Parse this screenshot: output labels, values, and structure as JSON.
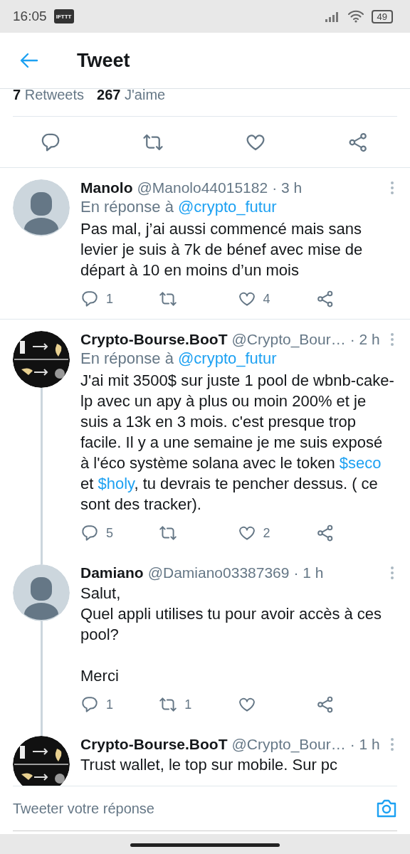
{
  "status_bar": {
    "time": "16:05",
    "notification": "IFTTT",
    "battery": "49"
  },
  "header": {
    "title": "Tweet"
  },
  "stats": [
    {
      "count": "7",
      "label": "Retweets"
    },
    {
      "count": "267",
      "label": "J'aime"
    }
  ],
  "tweets": [
    {
      "name": "Manolo",
      "handle": "@Manolo44015182",
      "time": "· 3 h",
      "kind": "default",
      "reply_prefix": "En réponse à",
      "reply_to": "@crypto_futur",
      "body": [
        {
          "text": "Pas mal, j’ai aussi commencé mais sans levier je suis à 7k de bénef avec mise de départ à 10 en moins d’un mois",
          "link": false
        }
      ],
      "replies": "1",
      "likes": "4",
      "connected_below": false
    },
    {
      "name": "Crypto-Bourse.BooT",
      "handle": "@Crypto_Bour…",
      "time": "· 2 h",
      "kind": "image",
      "reply_prefix": "En réponse à",
      "reply_to": "@crypto_futur",
      "body": [
        {
          "text": "J'ai mit 3500$ sur juste 1 pool de wbnb-cake-lp avec un apy à plus ou moin 200% et je suis a 13k en 3 mois. c'est presque trop facile. Il y a une semaine je me suis exposé à l'éco système solana avec le token ",
          "link": false
        },
        {
          "text": "$seco",
          "link": true
        },
        {
          "text": " et ",
          "link": false
        },
        {
          "text": "$holy",
          "link": true
        },
        {
          "text": ", tu devrais te pencher dessus. ( ce sont des tracker).",
          "link": false
        }
      ],
      "replies": "5",
      "likes": "2",
      "connected_below": true
    },
    {
      "name": "Damiano",
      "handle": "@Damiano03387369",
      "time": "· 1 h",
      "kind": "default",
      "body": [
        {
          "text": "Salut,\nQuel appli utilises tu pour avoir accès à ces pool?\n\nMerci",
          "link": false
        }
      ],
      "replies": "1",
      "retweets": "1",
      "connected_below": true
    },
    {
      "name": "Crypto-Bourse.BooT",
      "handle": "@Crypto_Bour…",
      "time": "· 1 h",
      "kind": "image",
      "body": [
        {
          "text": "Trust wallet, le top sur mobile. Sur pc",
          "link": false
        }
      ],
      "connected_below": false
    }
  ],
  "composer": {
    "placeholder": "Tweeter votre réponse"
  }
}
